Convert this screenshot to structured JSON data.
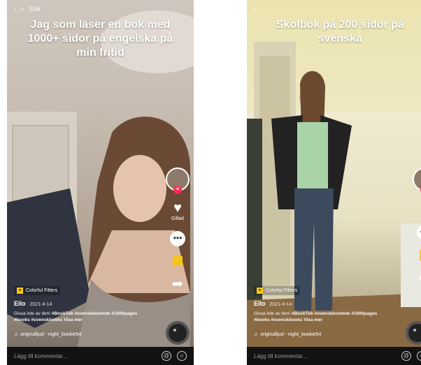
{
  "left_video": {
    "search_label": "Sök",
    "caption": "Jag som läser en bok med 1000+ sidor på engelska på min fritid",
    "rail": {
      "likes_count": "Gillad"
    },
    "effect_label": "Colorful Filters",
    "author": "Ello",
    "date": "2021-4-14",
    "description_plain": "Gissa inte av den!",
    "description_tags": "#BookTok #svenskbooktok #1000pages #books #svenskbooks",
    "see_more": "Visa mer",
    "sound": "originalljud - night_bookie54",
    "comment_placeholder": "Lägg till kommentar..."
  },
  "right_video": {
    "caption": "Skolbok på 200 sidor på svenska",
    "effect_label": "Colorful Filters",
    "author": "Ello",
    "date": "2021-4-14",
    "description_plain": "Gissa inte av den!",
    "description_tags": "#BookTok #svenskbooktok #1000pages #books #svenskbooks",
    "see_more": "Visa mer",
    "sound": "originalljud - night_bookie54",
    "comment_placeholder": "Lägg till kommentar..."
  },
  "colors": {
    "accent_red": "#fe2c55",
    "bookmark_yellow": "#f5c518",
    "comment_bar": "#121212"
  },
  "icons": [
    "back-arrow-icon",
    "search-icon",
    "heart-icon",
    "comment-icon",
    "bookmark-icon",
    "share-icon",
    "music-note-icon",
    "at-icon",
    "emoji-icon"
  ]
}
